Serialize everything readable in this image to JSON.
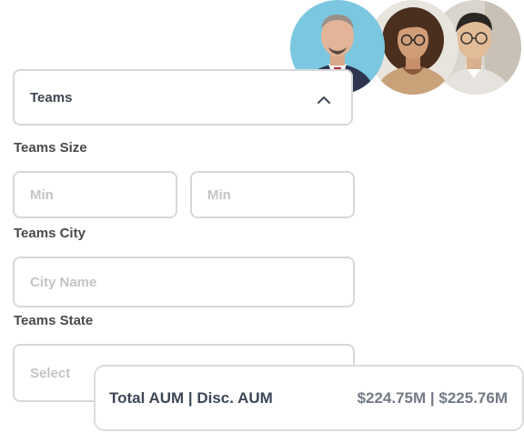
{
  "teams_dropdown": {
    "label": "Teams"
  },
  "teams_size": {
    "label": "Teams Size",
    "min_placeholder": "Min",
    "max_placeholder": "Min"
  },
  "teams_city": {
    "label": "Teams City",
    "placeholder": "City Name"
  },
  "teams_state": {
    "label": "Teams State",
    "placeholder": "Select"
  },
  "aum_card": {
    "label": "Total AUM | Disc. AUM",
    "value": "$224.75M | $225.76M"
  },
  "avatars": [
    {
      "name": "man-in-suit-avatar",
      "bg": "#7cc7e0"
    },
    {
      "name": "woman-with-glasses-avatar",
      "bg": "#e8e4de"
    },
    {
      "name": "man-with-glasses-avatar",
      "bg": "#d9d4cc"
    }
  ]
}
